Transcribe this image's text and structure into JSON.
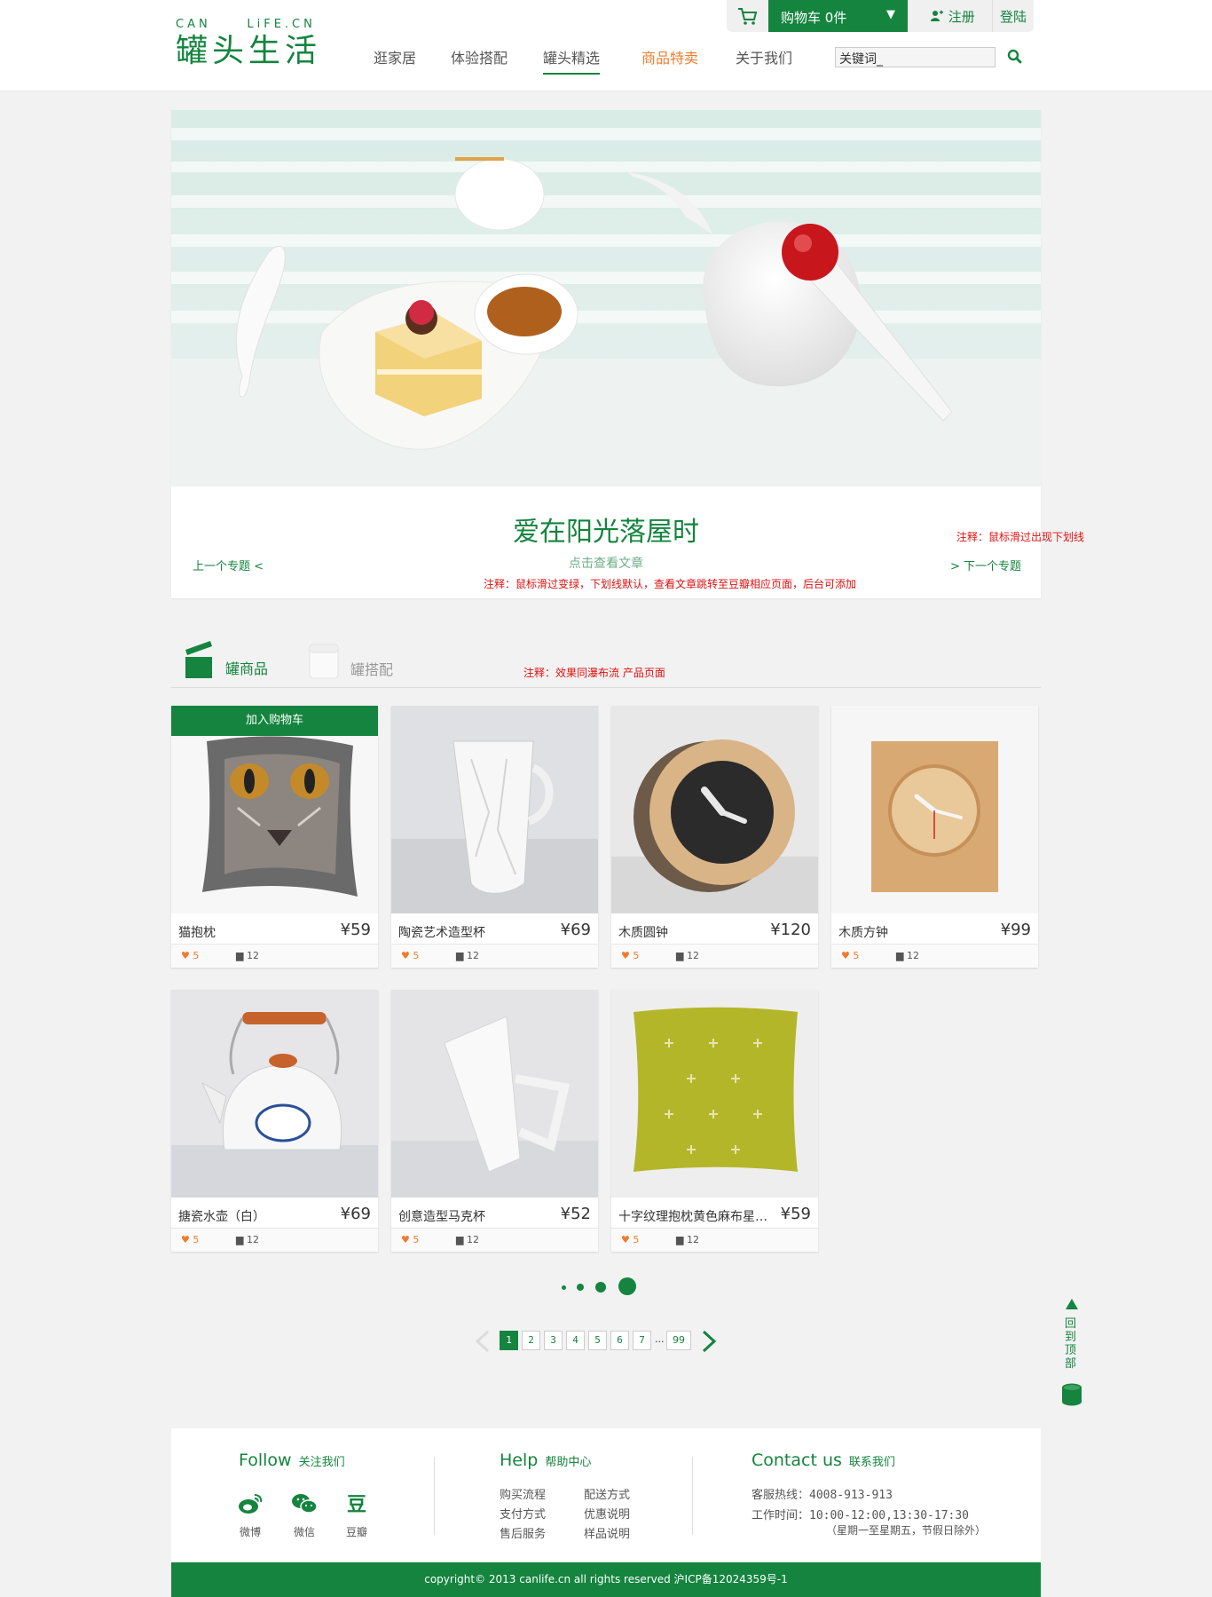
{
  "brand": {
    "logo_en": "CAN     LiFE.CN",
    "logo_cn": "罐头生活"
  },
  "nav": {
    "items": [
      "逛家居",
      "体验搭配",
      "罐头精选",
      "商品特卖",
      "关于我们"
    ]
  },
  "search": {
    "value": "关键词_"
  },
  "topbar": {
    "cart_label": "购物车",
    "cart_count": "0件",
    "register": "注册",
    "login": "登陆"
  },
  "banner": {
    "title": "爱在阳光落屋时",
    "more": "点击查看文章",
    "prev": "上一个专题  <",
    "next": ">  下一个专题",
    "note_right": "注释：鼠标滑过出现下划线",
    "note_center": "注释：鼠标滑过变绿，下划线默认，查看文章跳转至豆瓣相应页面，后台可添加"
  },
  "tabs": {
    "goods": "罐商品",
    "match": "罐搭配",
    "note": "注释：效果同瀑布流  产品页面"
  },
  "products": [
    {
      "name": "猫抱枕",
      "price": "¥59",
      "likes": "5",
      "comments": "12",
      "cart": "加入购物车"
    },
    {
      "name": "陶瓷艺术造型杯",
      "price": "¥69",
      "likes": "5",
      "comments": "12"
    },
    {
      "name": "木质圆钟",
      "price": "¥120",
      "likes": "5",
      "comments": "12"
    },
    {
      "name": "木质方钟",
      "price": "¥99",
      "likes": "5",
      "comments": "12"
    },
    {
      "name": "搪瓷水壶（白）",
      "price": "¥69",
      "likes": "5",
      "comments": "12"
    },
    {
      "name": "创意造型马克杯",
      "price": "¥52",
      "likes": "5",
      "comments": "12"
    },
    {
      "name": "十字纹理抱枕黄色麻布星…",
      "price": "¥59",
      "likes": "5",
      "comments": "12"
    }
  ],
  "pagination": {
    "pages": [
      "1",
      "2",
      "3",
      "4",
      "5",
      "6",
      "7"
    ],
    "ellipsis": "...",
    "last": "99",
    "current": "1"
  },
  "backtop": {
    "label": "回到顶部"
  },
  "footer": {
    "follow": {
      "title": "Follow",
      "sub": "关注我们",
      "items": [
        "微博",
        "微信",
        "豆瓣"
      ],
      "douban_glyph": "豆"
    },
    "help": {
      "title": "Help",
      "sub": "帮助中心",
      "col1": [
        "购买流程",
        "支付方式",
        "售后服务"
      ],
      "col2": [
        "配送方式",
        "优惠说明",
        "样品说明"
      ]
    },
    "contact": {
      "title": "Contact us",
      "sub": "联系我们",
      "hotline": "客服热线：4008-913-913",
      "hours": "工作时间：10:00-12:00,13:30-17:30",
      "days": "（星期一至星期五，节假日除外）"
    },
    "copyright": "copyright© 2013 canlife.cn all rights reserved    沪ICP备12024359号-1"
  },
  "colors": {
    "brand_green": "#14843e",
    "accent_orange": "#f07b2c",
    "note_red": "#e01010"
  }
}
